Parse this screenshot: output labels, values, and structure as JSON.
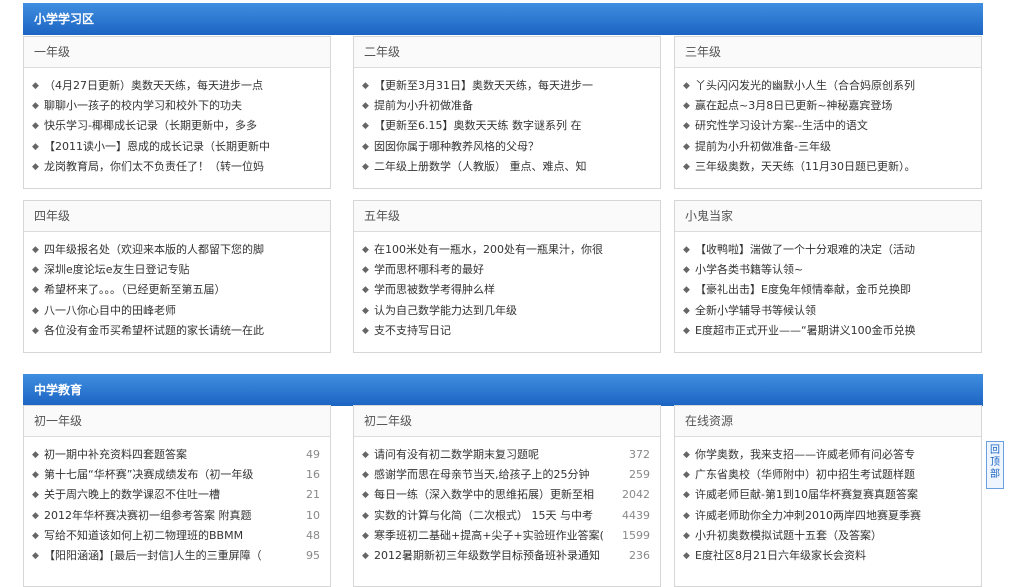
{
  "sections": [
    {
      "title": "小学学习区",
      "panels": [
        {
          "title": "一年级",
          "items": [
            {
              "text": "（4月27日更新）奥数天天练，每天进步一点"
            },
            {
              "text": "聊聊小一孩子的校内学习和校外下的功夫"
            },
            {
              "text": "快乐学习-椰椰成长记录（长期更新中，多多"
            },
            {
              "text": "【2011读小一】恩成的成长记录（长期更新中"
            },
            {
              "text": "龙岗教育局，你们太不负责任了！（转一位妈"
            }
          ]
        },
        {
          "title": "二年级",
          "items": [
            {
              "text": "【更新至3月31日】奥数天天练，每天进步一"
            },
            {
              "text": "提前为小升初做准备"
            },
            {
              "text": "【更新至6.15】奥数天天练 数字谜系列 在"
            },
            {
              "text": "囡囡你属于哪种教养风格的父母？"
            },
            {
              "text": "二年级上册数学（人教版） 重点、难点、知"
            }
          ]
        },
        {
          "title": "三年级",
          "items": [
            {
              "text": "丫头闪闪发光的幽默小人生（合合妈原创系列"
            },
            {
              "text": "赢在起点~3月8日已更新~神秘嘉宾登场"
            },
            {
              "text": "研究性学习设计方案--生活中的语文"
            },
            {
              "text": "提前为小升初做准备-三年级"
            },
            {
              "text": "三年级奥数，天天练（11月30日题已更新）。"
            }
          ]
        },
        {
          "title": "四年级",
          "items": [
            {
              "text": "四年级报名处（欢迎来本版的人都留下您的脚"
            },
            {
              "text": "深圳e度论坛e友生日登记专贴"
            },
            {
              "text": "希望杯来了。。。（已经更新至第五届）"
            },
            {
              "text": "八一八你心目中的田峰老师"
            },
            {
              "text": "各位没有金币买希望杯试题的家长请统一在此"
            }
          ]
        },
        {
          "title": "五年级",
          "items": [
            {
              "text": "在100米处有一瓶水，200处有一瓶果汁，你很"
            },
            {
              "text": "学而思杯哪科考的最好"
            },
            {
              "text": "学而思被数学考得肿么样"
            },
            {
              "text": "认为自己数学能力达到几年级"
            },
            {
              "text": "支不支持写日记"
            }
          ]
        },
        {
          "title": "小鬼当家",
          "items": [
            {
              "text": "【收鸭啦】湍做了一个十分艰难的决定（活动"
            },
            {
              "text": "小学各类书籍等认领~"
            },
            {
              "text": "【豪礼出击】E度兔年倾情奉献，金币兑换即"
            },
            {
              "text": "全新小学辅导书等候认领"
            },
            {
              "text": "E度超市正式开业——“暑期讲义100金币兑换"
            }
          ]
        }
      ]
    },
    {
      "title": "中学教育",
      "panels": [
        {
          "title": "初一年级",
          "items": [
            {
              "text": "初一期中补充资料四套题答案",
              "count": "49"
            },
            {
              "text": "第十七届“华杯赛”决赛成绩发布（初一年级",
              "count": "16"
            },
            {
              "text": "关于周六晚上的数学课忍不住吐一槽",
              "count": "21"
            },
            {
              "text": "2012年华杯赛决赛初一组参考答案 附真题",
              "count": "10"
            },
            {
              "text": "写给不知道该如何上初二物理班的BBMM",
              "count": "48"
            },
            {
              "text": "【阳阳涵涵】[最后一封信]人生的三重屏障（",
              "count": "95"
            }
          ]
        },
        {
          "title": "初二年级",
          "items": [
            {
              "text": "请问有没有初二数学期末复习题呢",
              "count": "372"
            },
            {
              "text": "感谢学而思在母亲节当天,给孩子上的25分钟",
              "count": "259"
            },
            {
              "text": "每日一练（深入数学中的思维拓展）更新至相",
              "count": "2042"
            },
            {
              "text": "实数的计算与化简（二次根式） 15天 与中考",
              "count": "4439"
            },
            {
              "text": "寒季班初二基础+提高+尖子+实验班作业答案(",
              "count": "1599"
            },
            {
              "text": "2012暑期新初三年级数学目标预备班补录通知",
              "count": "236"
            }
          ]
        },
        {
          "title": "在线资源",
          "items": [
            {
              "text": "你学奥数，我来支招——许威老师有问必答专"
            },
            {
              "text": "广东省奥校（华师附中）初中招生考试题样题"
            },
            {
              "text": "许威老师巨献-第1到10届华杯赛复赛真题答案"
            },
            {
              "text": "许威老师助你全力冲刺2010两岸四地赛夏季赛"
            },
            {
              "text": "小升初奥数模拟试题十五套（及答案）"
            },
            {
              "text": "E度社区8月21日六年级家长会资料"
            }
          ]
        }
      ]
    }
  ],
  "back_to_top": "回顶部"
}
